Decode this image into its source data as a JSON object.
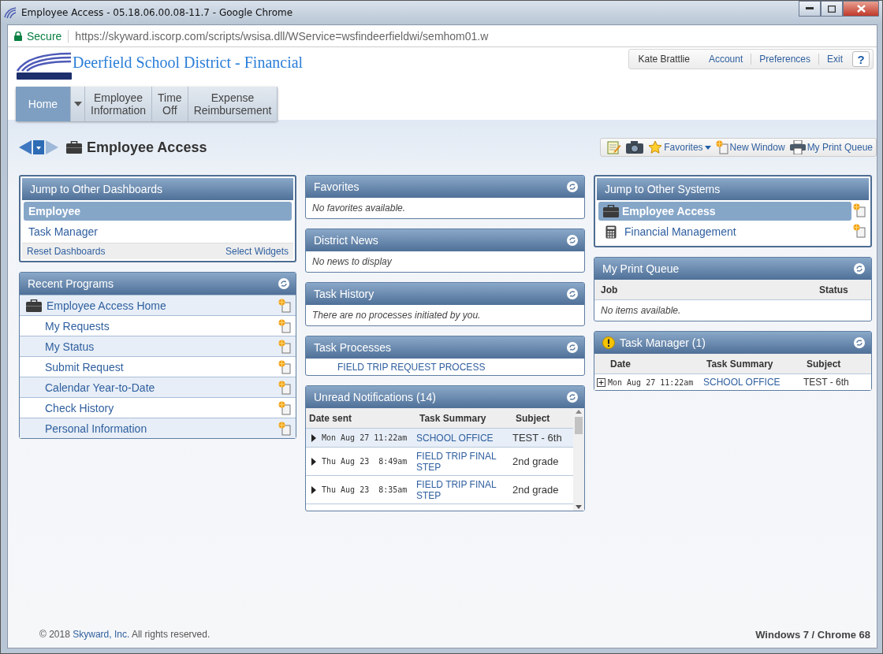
{
  "window": {
    "title": "Employee Access - 05.18.06.00.08-11.7 - Google Chrome"
  },
  "address_bar": {
    "security": "Secure",
    "url": "https://skyward.iscorp.com/scripts/wsisa.dll/WService=wsfindeerfieldwi/semhom01.w"
  },
  "header": {
    "district": "Deerfield School District - Financial",
    "user": "Kate Brattlie",
    "links": [
      "Account",
      "Preferences",
      "Exit"
    ],
    "help": "?"
  },
  "nav_tabs": [
    {
      "label": "Home",
      "selected": true,
      "dropdown": true
    },
    {
      "label": "Employee Information",
      "selected": false,
      "dropdown": false
    },
    {
      "label": "Time Off",
      "selected": false,
      "dropdown": false
    },
    {
      "label": "Expense Reimbursement",
      "selected": false,
      "dropdown": false
    }
  ],
  "page_title": "Employee Access",
  "toolbar": [
    {
      "kind": "notes"
    },
    {
      "kind": "camera"
    },
    {
      "kind": "favorites",
      "label": "Favorites"
    },
    {
      "kind": "window",
      "label": "New Window"
    },
    {
      "kind": "print",
      "label": "My Print Queue"
    }
  ],
  "dashboards": {
    "title": "Jump to Other Dashboards",
    "items": [
      {
        "label": "Employee",
        "selected": true
      },
      {
        "label": "Task Manager",
        "selected": false
      }
    ],
    "footer_links": [
      "Reset Dashboards",
      "Select Widgets"
    ]
  },
  "recent_programs": {
    "title": "Recent Programs",
    "items": [
      {
        "label": "Employee Access Home",
        "kind": "home"
      },
      {
        "label": "My Requests",
        "kind": "page"
      },
      {
        "label": "My Status",
        "kind": "page"
      },
      {
        "label": "Submit Request",
        "kind": "page"
      },
      {
        "label": "Calendar Year-to-Date",
        "kind": "page"
      },
      {
        "label": "Check History",
        "kind": "page"
      },
      {
        "label": "Personal Information",
        "kind": "page"
      }
    ]
  },
  "favorites": {
    "title": "Favorites",
    "message": "No favorites available."
  },
  "district_news": {
    "title": "District News",
    "message": "No news to display"
  },
  "task_history": {
    "title": "Task History",
    "message": "There are no processes initiated by you."
  },
  "task_processes": {
    "title": "Task Processes",
    "items": [
      "FIELD TRIP REQUEST PROCESS"
    ]
  },
  "notifications": {
    "title": "Unread Notifications (14)",
    "columns": [
      "Date sent",
      "Task Summary",
      "Subject"
    ],
    "rows": [
      {
        "date": "Mon Aug 27 11:22am",
        "summary": "SCHOOL OFFICE",
        "subject": "TEST - 6th",
        "selected": true,
        "expanded": false
      },
      {
        "date": "Thu Aug 23  8:49am",
        "summary": "FIELD TRIP FINAL STEP",
        "subject": "2nd grade",
        "selected": false,
        "expanded": false
      },
      {
        "date": "Thu Aug 23  8:35am",
        "summary": "FIELD TRIP FINAL STEP",
        "subject": "2nd grade",
        "selected": false,
        "expanded": false
      }
    ]
  },
  "systems": {
    "title": "Jump to Other Systems",
    "items": [
      {
        "label": "Employee Access",
        "kind": "briefcase",
        "selected": true
      },
      {
        "label": "Financial Management",
        "kind": "calculator",
        "selected": false
      }
    ]
  },
  "print_queue": {
    "title": "My Print Queue",
    "columns": [
      "Job",
      "Status"
    ],
    "message": "No items available."
  },
  "task_manager": {
    "title": "Task Manager (1)",
    "columns": [
      "Date",
      "Task Summary",
      "Subject"
    ],
    "rows": [
      {
        "date": "Mon Aug 27 11:22am",
        "summary": "SCHOOL OFFICE",
        "subject": "TEST - 6th",
        "expanded": false
      }
    ]
  },
  "footer": {
    "copyright_before": "© 2018",
    "copyright_link": "Skyward, Inc.",
    "copyright_after": "All rights reserved.",
    "platform": "Windows 7 / Chrome 68"
  }
}
